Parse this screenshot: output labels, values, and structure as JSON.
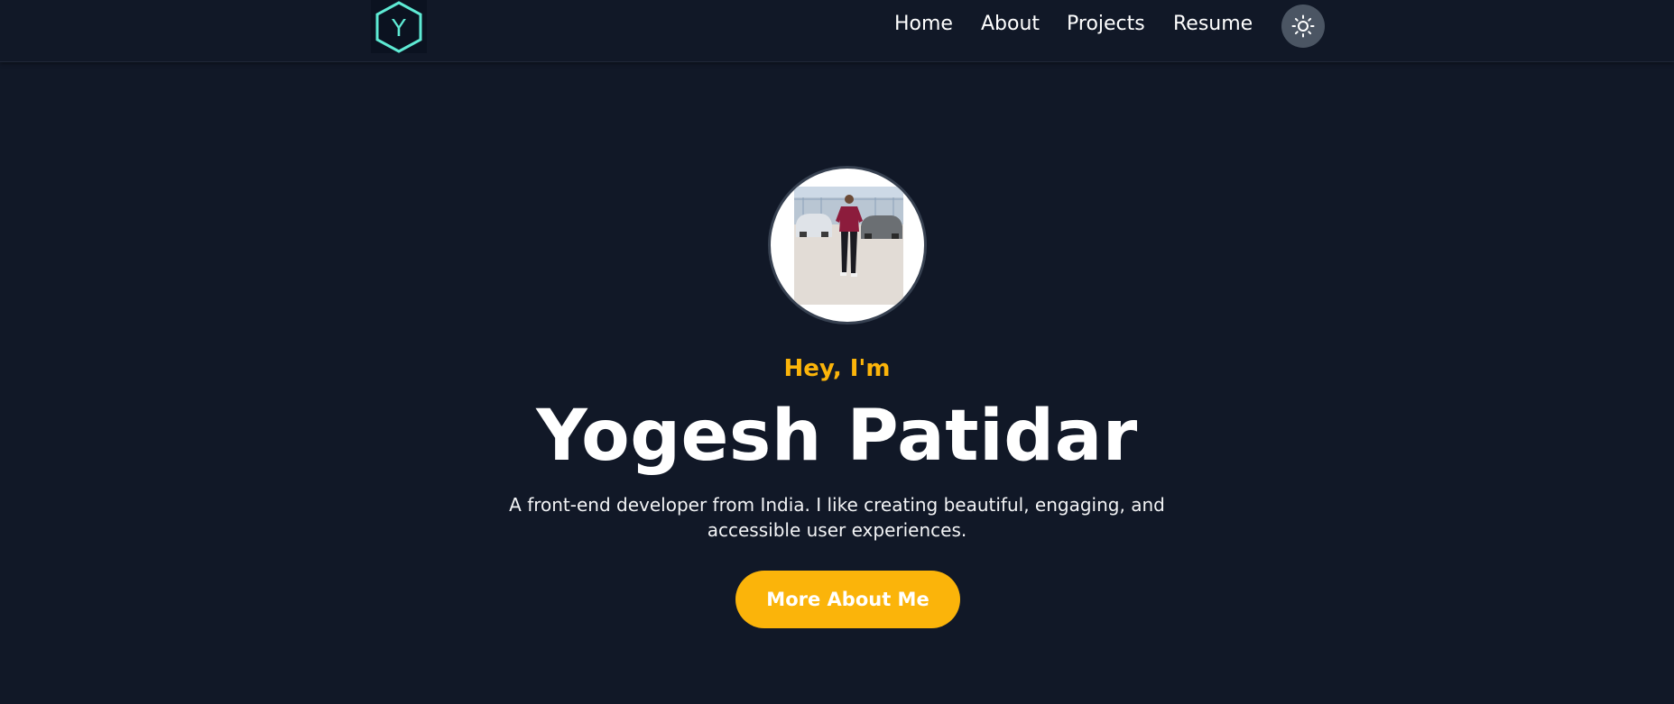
{
  "header": {
    "logo_letter": "Y",
    "nav": [
      {
        "label": "Home"
      },
      {
        "label": "About"
      },
      {
        "label": "Projects"
      },
      {
        "label": "Resume"
      }
    ],
    "theme_toggle_icon": "sun-icon"
  },
  "hero": {
    "greeting": "Hey, I'm",
    "name": "Yogesh Patidar",
    "tagline": "A front-end developer from India. I like creating beautiful, engaging, and accessible user experiences.",
    "cta_label": "More About Me"
  },
  "colors": {
    "background": "#111827",
    "accent": "#fbb40a",
    "logo": "#5eead4",
    "toggle_bg": "#4b5563"
  }
}
